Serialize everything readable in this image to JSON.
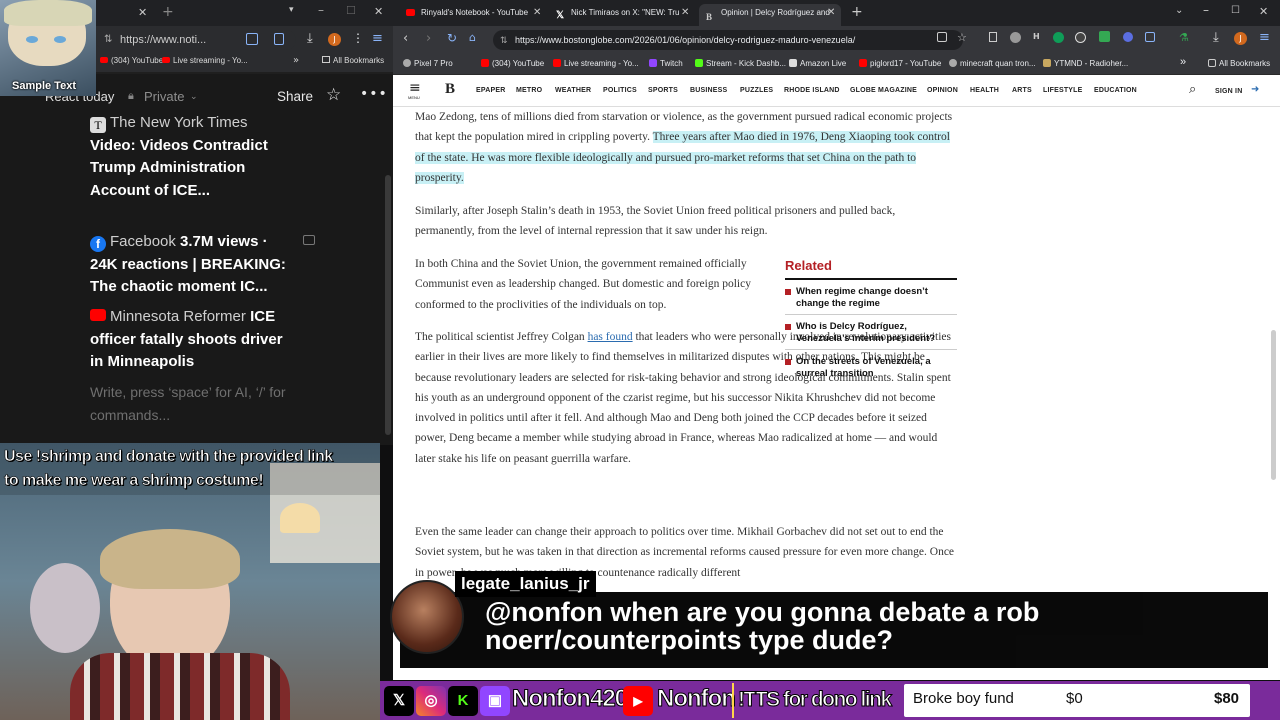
{
  "left_browser": {
    "url": "https://www.noti...",
    "bookmarks": [
      "(304) YouTube",
      "Live streaming - Yo...",
      "All Bookmarks"
    ],
    "webcam_label": "Sample Text",
    "page_title": "React today",
    "privacy": "Private",
    "share": "Share",
    "feed": [
      {
        "source": "The New York Times",
        "title": "Video: Videos Contradict Trump Administration Account of ICE..."
      },
      {
        "source": "Facebook",
        "title": "3.7M views · 24K reactions | BREAKING: The chaotic moment IC..."
      },
      {
        "source": "Minnesota Reformer",
        "title": "ICE officer fatally shoots driver in Minneapolis"
      }
    ],
    "editor_placeholder": "Write, press ‘space’ for AI, ‘/’ for commands..."
  },
  "stream": {
    "shrimp_banner": "Use !shrimp and donate with the provided link to make me wear a shrimp costume!",
    "chat_user": "legate_lanius_jr",
    "chat_message": "@nonfon when are you gonna debate a rob noerr/counterpoints type dude?",
    "social_name_1": "Nonfon420",
    "social_name_2": "Nonfon",
    "tts_text": "!TTS for dono link",
    "goal_label": "Broke boy fund",
    "goal_current": "$0",
    "goal_target": "$80",
    "goal_progress": 0
  },
  "right_browser": {
    "tabs": [
      "Rinyald's Notebook - YouTube",
      "Nick Timiraos on X: \"NEW: Tru",
      "Opinion | Delcy Rodríguez and"
    ],
    "url": "https://www.bostonglobe.com/2026/01/06/opinion/delcy-rodriguez-maduro-venezuela/",
    "bookmarks": [
      "Pixel 7 Pro",
      "(304) YouTube",
      "Live streaming - Yo...",
      "Twitch",
      "Stream - Kick Dashb...",
      "Amazon Live",
      "piglord17 - YouTube",
      "minecraft quan tron...",
      "YTMND - Radioher...",
      "All Bookmarks"
    ],
    "nav": [
      "MENU",
      "EPAPER",
      "METRO",
      "WEATHER",
      "POLITICS",
      "SPORTS",
      "BUSINESS",
      "PUZZLES",
      "RHODE ISLAND",
      "GLOBE MAGAZINE",
      "OPINION",
      "HEALTH",
      "ARTS",
      "LIFESTYLE",
      "EDUCATION",
      "SIGN IN"
    ],
    "article": {
      "p1a": "Mao Zedong, tens of millions died from starvation or violence, as the government pursued radical economic projects that kept the population mired in crippling poverty. ",
      "p1b": "Three years after Mao died in 1976, Deng Xiaoping took control of the state. He was more flexible ideologically and pursued pro-market reforms that set China on the path to prosperity.",
      "p2": "Similarly, after Joseph Stalin’s death in 1953, the Soviet Union freed political prisoners and pulled back, permanently, from the level of internal repression that it saw under his reign.",
      "p3": "In both China and the Soviet Union, the government remained officially Communist even as leadership changed. But domestic and foreign policy conformed to the proclivities of the individuals on top.",
      "p4a": "The political scientist Jeffrey Colgan ",
      "p4link": "has found",
      "p4b": " that leaders who were personally involved in revolutionary activities earlier in their lives are more likely to find themselves in militarized disputes with other nations. This might be because revolutionary leaders are selected for risk-taking behavior and strong ideological commitments. Stalin spent his youth as an underground opponent of the czarist regime, but his successor Nikita Khrushchev did not become involved in politics until after it fell. And although Mao and Deng both joined the CCP decades before it seized power, Deng became a member while studying abroad in France, whereas Mao radicalized at home — and would later stake his life on peasant guerrilla warfare.",
      "p5": "Even the same leader can change their approach to politics over time. Mikhail Gorbachev did not set out to end the Soviet system, but he was taken in that direction as incremental reforms caused pressure for even more change. Once in power, he was much more willing to countenance radically different"
    },
    "related": {
      "title": "Related",
      "items": [
        "When regime change doesn’t change the regime",
        "Who is Delcy Rodríguez, Venezuela’s interim president?",
        "On the streets of Venezuela, a surreal transition"
      ]
    }
  },
  "colors": {
    "twitch_purple": "#7a2b9b",
    "globe_red": "#b42025",
    "highlight": "#c8f0f5"
  }
}
